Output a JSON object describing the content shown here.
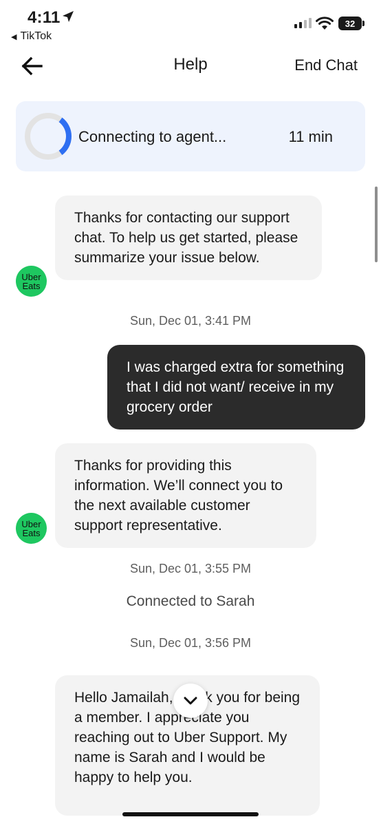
{
  "status_bar": {
    "time": "4:11",
    "back_app": "TikTok",
    "battery": "32"
  },
  "header": {
    "title": "Help",
    "end_chat_label": "End Chat"
  },
  "connecting": {
    "text": "Connecting to agent...",
    "wait": "11 min"
  },
  "avatar_label_line1": "Uber",
  "avatar_label_line2": "Eats",
  "messages": [
    {
      "from": "agent",
      "text": "Thanks for contacting our support chat. To help us get started, please summarize your issue below."
    },
    {
      "from": "user",
      "text": "I was charged extra for something that I did not want/ receive in my grocery order"
    },
    {
      "from": "agent",
      "text": "Thanks for providing this information. We’ll connect you to the next available customer support representative."
    },
    {
      "from": "agent",
      "text": "Hello Jamailah, thank you for being a member. I appreciate you reaching out to Uber Support. My name is Sarah and I would be happy to help you."
    }
  ],
  "timestamps": [
    "Sun, Dec 01, 3:41 PM",
    "Sun, Dec 01, 3:55 PM",
    "Sun, Dec 01, 3:56 PM"
  ],
  "system_message": "Connected to Sarah",
  "colors": {
    "accent_blue": "#2e6ff2",
    "card_bg": "#eef3fd",
    "uber_eats_green": "#1ec760",
    "user_bubble": "#2b2b2b",
    "agent_bubble": "#f3f3f3"
  }
}
